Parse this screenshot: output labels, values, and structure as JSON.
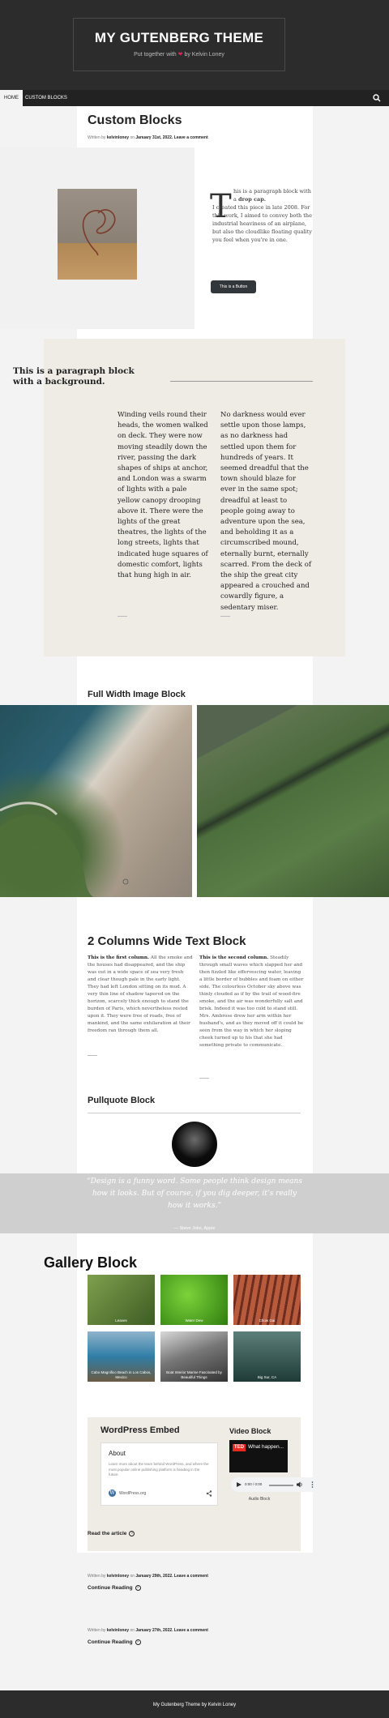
{
  "header": {
    "site_title": "MY GUTENBERG THEME",
    "tagline_before": "Put together with",
    "tagline_after": "by Kelvin Loney"
  },
  "nav": {
    "items": [
      {
        "label": "HOME"
      },
      {
        "label": "CUSTOM BLOCKS"
      }
    ]
  },
  "post": {
    "title": "Custom Blocks",
    "meta_prefix": "Written by",
    "author": "kelvinloney",
    "meta_on": "on",
    "date": "January 31st, 2022.",
    "comment_link": "Leave a comment"
  },
  "media_text": {
    "drop_cap": "T",
    "text_before_bold": "his is a paragraph block with a",
    "bold": "drop cap.",
    "text_after_bold": "I created this piece in late 2008. For this work, I aimed to convey both the industrial heaviness of an airplane, but also the cloudlike floating quality you feel when you're in one.",
    "button_label": "This is a Button"
  },
  "bg_paragraph": {
    "heading": "This is a paragraph block with a background.",
    "col_left": "Winding veils round their heads, the women walked on deck. They were now moving steadily down the river, passing the dark shapes of ships at anchor, and London was a swarm of lights with a pale yellow canopy drooping above it. There were the lights of the great theatres, the lights of the long streets, lights that indicated huge squares of domestic comfort, lights that hung high in air.",
    "col_right": "No darkness would ever settle upon those lamps, as no darkness had settled upon them for hundreds of years. It seemed dreadful that the town should blaze for ever in the same spot; dreadful at least to people going away to adventure upon the sea, and beholding it as a circumscribed mound, eternally burnt, eternally scarred. From the deck of the ship the great city appeared a crouched and cowardly figure, a sedentary miser."
  },
  "full_width": {
    "title": "Full Width Image Block"
  },
  "two_columns": {
    "title": "2 Columns Wide Text Block",
    "left_bold": "This is the first column.",
    "left_text": "All the smoke and the houses had disappeared, and the ship was out in a wide space of sea very fresh and clear though pale in the early light. They had left London sitting on its mud. A very thin line of shadow tapered on the horizon, scarcely thick enough to stand the burden of Paris, which nevertheless rested upon it. They were free of roads, free of mankind, and the same exhilaration at their freedom ran through them all.",
    "right_bold": "This is the second column.",
    "right_text": "Steadily through small waves which slapped her and then fizzled like effervescing water, leaving a little border of bubbles and foam on either side. The colourless October sky above was thinly clouded as if by the trail of wood-fire smoke, and the air was wonderfully salt and brisk. Indeed it was too cold to stand still. Mrs. Ambrose drew her arm within her husband's, and as they moved off it could be seen from the way in which her sloping cheek turned up to his that she had something private to communicate."
  },
  "pullquote": {
    "title": "Pullquote Block",
    "quote": "“Design is a funny word. Some people think design means how it looks. But of course, if you dig deeper, it’s really how it works.”",
    "cite": "— Steve Jobs, Apple"
  },
  "gallery": {
    "title": "Gallery Block",
    "items": [
      {
        "caption": "Leaves",
        "colors": [
          "#7fa04e",
          "#3d5c23"
        ]
      },
      {
        "caption": "Water Dew",
        "colors": [
          "#7cd33a",
          "#2f7d10"
        ]
      },
      {
        "caption": "Chow Gai",
        "colors": [
          "#b85a3c",
          "#6d2d1e"
        ]
      },
      {
        "caption": "Cabo Magnifico Beach in Los Cabos, Mexico",
        "colors": [
          "#2f7ea6",
          "#6b5a43"
        ]
      },
      {
        "caption": "Boat Interior Marine Fascinated by Beautiful Things",
        "colors": [
          "#d8d8d8",
          "#333333"
        ]
      },
      {
        "caption": "Big Sur, CA",
        "colors": [
          "#5d7f79",
          "#1f3b37"
        ]
      }
    ]
  },
  "embed": {
    "title": "WordPress Embed",
    "about": "About",
    "desc": "Learn more about the team behind WordPress, and where the most popular online publishing platform is heading in the future.",
    "logo": "W",
    "site": "WordPress.org"
  },
  "video": {
    "title": "Video Block",
    "ted": "TED",
    "name": "What happen...",
    "time": "0:00 / 0:00",
    "audio_label": "Audio Block"
  },
  "read_article": "Read the article",
  "posts": [
    {
      "meta_prefix": "Written by",
      "author": "kelvinloney",
      "meta_on": "on",
      "date": "January 29th, 2022.",
      "comment": "Leave a comment",
      "link": "Continue Reading"
    },
    {
      "meta_prefix": "Written by",
      "author": "kelvinloney",
      "meta_on": "on",
      "date": "January 27th, 2022.",
      "comment": "Leave a comment",
      "link": "Continue Reading"
    }
  ],
  "footer": {
    "text": "My Gutenberg Theme by Kelvin Loney"
  },
  "colors": {
    "header_bg": "#2c2c2c",
    "heart": "#e0245e",
    "button_bg": "#32373c",
    "bg_block": "#efece6"
  }
}
